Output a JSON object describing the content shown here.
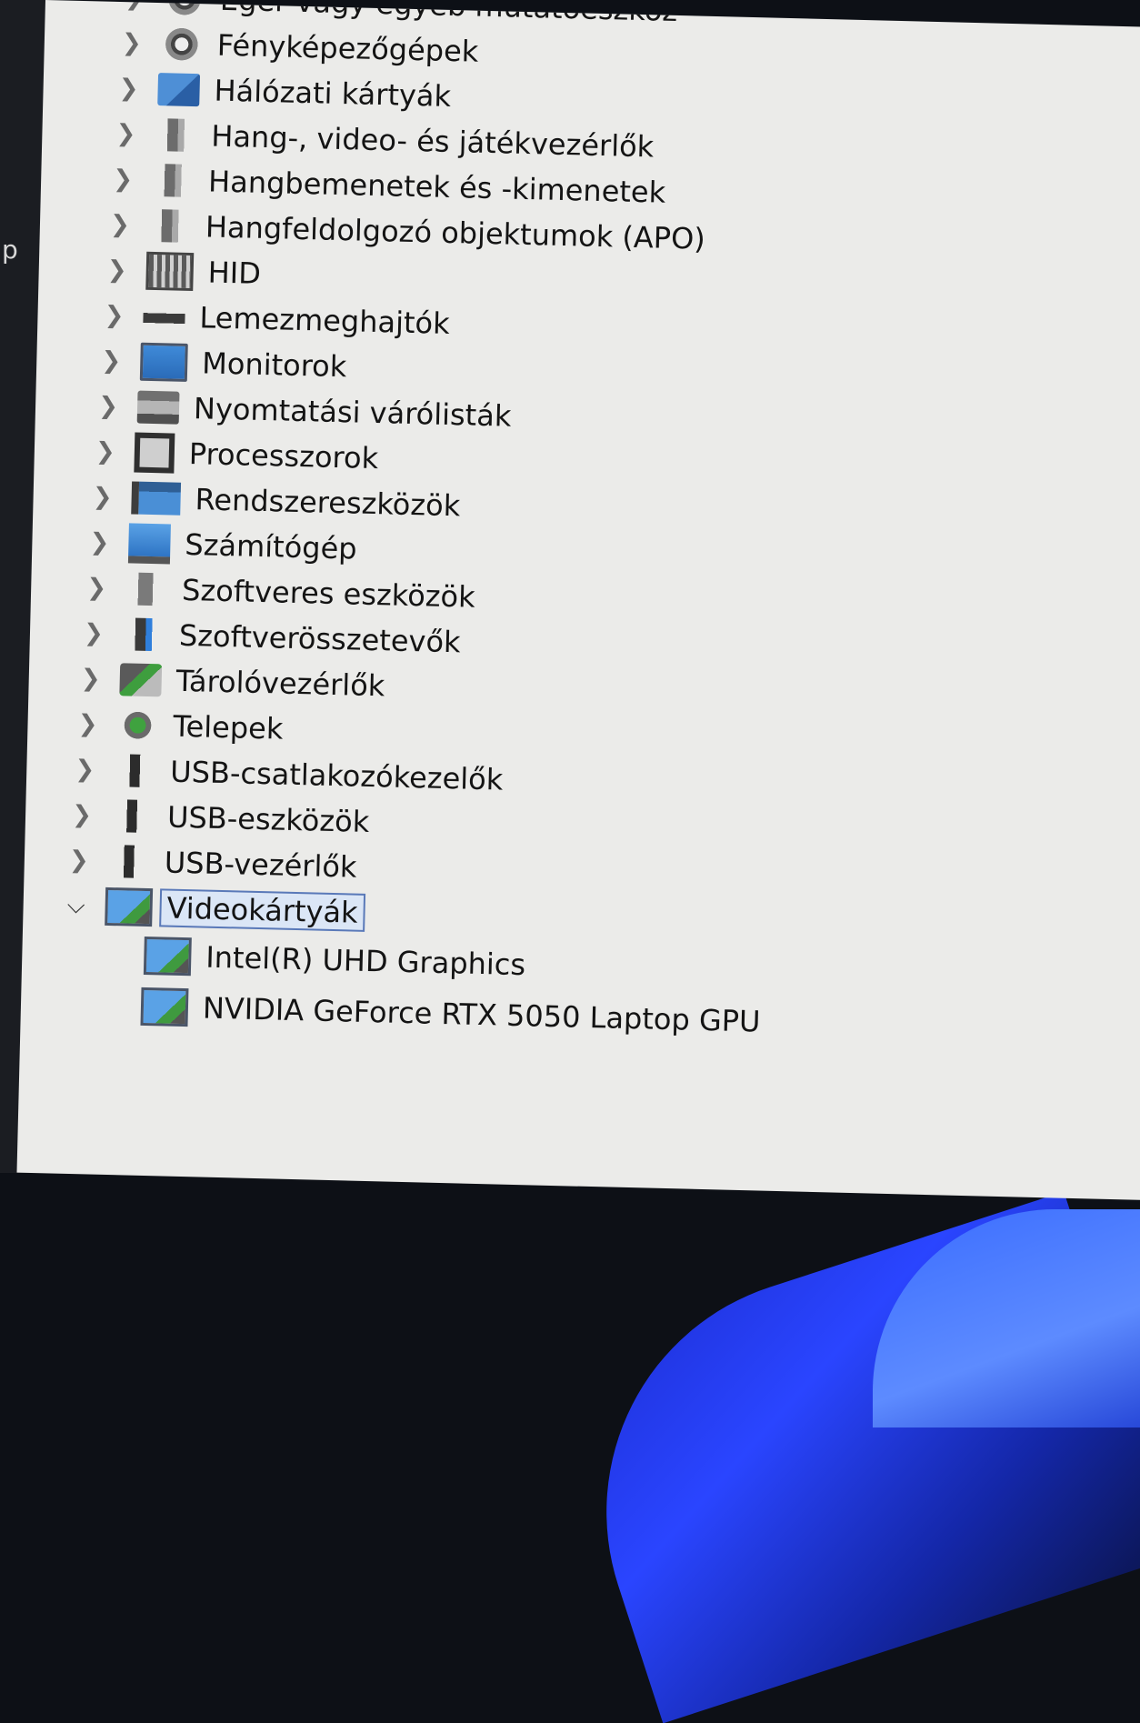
{
  "sidebar": {
    "partial_text": "p"
  },
  "device_tree": {
    "categories": [
      {
        "label": "Egér vagy egyéb mutatóeszköz",
        "icon": "mouse-icon",
        "expanded": false
      },
      {
        "label": "Fényképezőgépek",
        "icon": "camera-icon",
        "expanded": false
      },
      {
        "label": "Hálózati kártyák",
        "icon": "network-adapter-icon",
        "expanded": false
      },
      {
        "label": "Hang-, video- és játékvezérlők",
        "icon": "speaker-icon",
        "expanded": false
      },
      {
        "label": "Hangbemenetek és -kimenetek",
        "icon": "speaker-icon",
        "expanded": false
      },
      {
        "label": "Hangfeldolgozó objektumok (APO)",
        "icon": "speaker-icon",
        "expanded": false
      },
      {
        "label": "HID",
        "icon": "hid-icon",
        "expanded": false
      },
      {
        "label": "Lemezmeghajtók",
        "icon": "disk-drive-icon",
        "expanded": false
      },
      {
        "label": "Monitorok",
        "icon": "monitor-icon",
        "expanded": false
      },
      {
        "label": "Nyomtatási várólisták",
        "icon": "printer-icon",
        "expanded": false
      },
      {
        "label": "Processzorok",
        "icon": "processor-icon",
        "expanded": false
      },
      {
        "label": "Rendszereszközök",
        "icon": "system-devices-icon",
        "expanded": false
      },
      {
        "label": "Számítógép",
        "icon": "computer-icon",
        "expanded": false
      },
      {
        "label": "Szoftveres eszközök",
        "icon": "software-device-icon",
        "expanded": false
      },
      {
        "label": "Szoftverösszetevők",
        "icon": "software-component-icon",
        "expanded": false
      },
      {
        "label": "Tárolóvezérlők",
        "icon": "storage-controller-icon",
        "expanded": false
      },
      {
        "label": "Telepek",
        "icon": "battery-icon",
        "expanded": false
      },
      {
        "label": "USB-csatlakozókezelők",
        "icon": "usb-icon",
        "expanded": false
      },
      {
        "label": "USB-eszközök",
        "icon": "usb-icon",
        "expanded": false
      },
      {
        "label": "USB-vezérlők",
        "icon": "usb-icon",
        "expanded": false
      },
      {
        "label": "Videokártyák",
        "icon": "display-adapter-icon",
        "expanded": true,
        "selected": true,
        "children": [
          {
            "label": "Intel(R) UHD Graphics",
            "icon": "display-adapter-icon"
          },
          {
            "label": "NVIDIA GeForce RTX 5050 Laptop GPU",
            "icon": "display-adapter-icon"
          }
        ]
      }
    ]
  }
}
